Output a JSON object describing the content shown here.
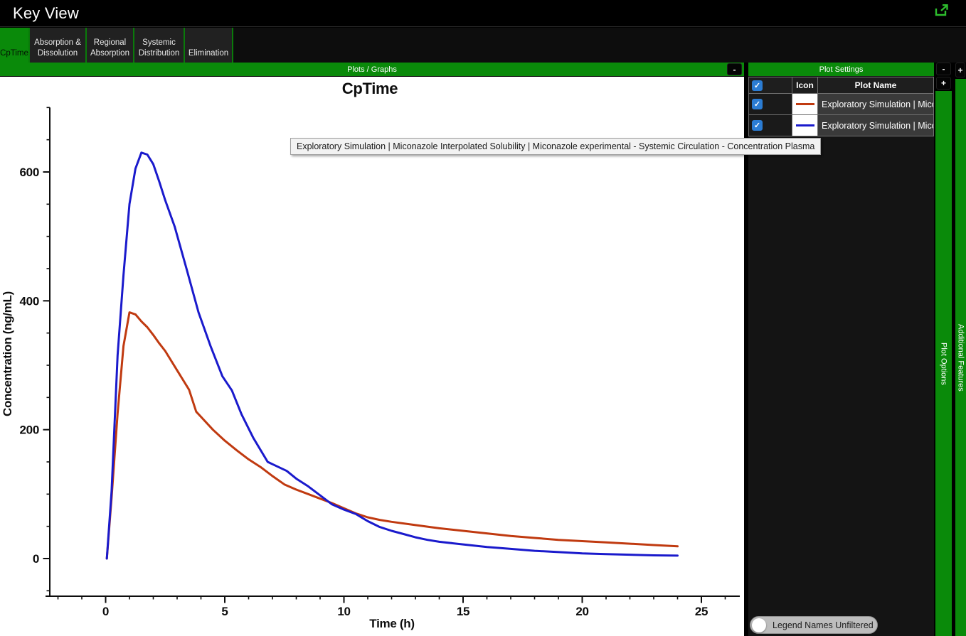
{
  "titlebar": {
    "title": "Key View",
    "icon": "open-external-icon"
  },
  "tabs": [
    {
      "label": "CpTime",
      "selected": true
    },
    {
      "label": "Absorption & Dissolution",
      "selected": false
    },
    {
      "label": "Regional Absorption",
      "selected": false
    },
    {
      "label": "Systemic Distribution",
      "selected": false
    },
    {
      "label": "Elimination",
      "selected": false
    }
  ],
  "plots_panel": {
    "title": "Plots / Graphs",
    "collapse_label": "-"
  },
  "plot_settings": {
    "title": "Plot Settings",
    "collapse_label": "-",
    "add_row_label": "+",
    "header_checked": true,
    "columns": {
      "icon": "Icon",
      "name": "Plot Name"
    },
    "rows": [
      {
        "checked": true,
        "line_color": "#c03a10",
        "name": "Exploratory Simulation | Mico"
      },
      {
        "checked": true,
        "line_color": "#1a1acc",
        "name": "Exploratory Simulation | Mico"
      }
    ]
  },
  "side_tabs": {
    "plot_options": {
      "label": "Plot Options"
    },
    "additional_features": {
      "label": "Additional Features",
      "add_label": "+"
    }
  },
  "tooltip": {
    "text": "Exploratory Simulation | Miconazole Interpolated Solubility | Miconazole experimental - Systemic Circulation - Concentration Plasma"
  },
  "legend_toggle": {
    "label": "Legend Names Unfiltered",
    "on": false
  },
  "colors": {
    "accent_green": "#0a8a0a",
    "titlebar_icon_green": "#2dbd2d",
    "checkbox_blue": "#2b7cd3",
    "series_red": "#c03a10",
    "series_blue": "#1a1acc",
    "axis_black": "#0d0d0d"
  },
  "chart_data": {
    "type": "line",
    "title": "CpTime",
    "xlabel": "Time (h)",
    "ylabel": "Concentration (ng/mL)",
    "xlim": [
      -2.5,
      26.6
    ],
    "ylim": [
      -58,
      700
    ],
    "x_ticks_major": [
      0,
      5,
      10,
      15,
      20,
      25
    ],
    "x_minor_step": 1,
    "x_minor_range": [
      -2,
      26
    ],
    "y_ticks_major": [
      0,
      200,
      400,
      600
    ],
    "y_minor_step": 50,
    "y_minor_range": [
      -50,
      700
    ],
    "grid": false,
    "legend_position": "none",
    "series": [
      {
        "name": "Exploratory Simulation | Mico (red)",
        "color": "#c03a10",
        "points": [
          [
            0.05,
            0
          ],
          [
            0.25,
            95
          ],
          [
            0.5,
            225
          ],
          [
            0.75,
            330
          ],
          [
            1,
            382
          ],
          [
            1.25,
            379
          ],
          [
            1.5,
            368
          ],
          [
            1.75,
            359
          ],
          [
            2,
            347
          ],
          [
            2.25,
            334
          ],
          [
            2.5,
            322
          ],
          [
            3,
            292
          ],
          [
            3.5,
            262
          ],
          [
            3.8,
            228
          ],
          [
            4,
            220
          ],
          [
            4.5,
            200
          ],
          [
            5,
            183
          ],
          [
            5.5,
            168
          ],
          [
            6,
            154
          ],
          [
            6.5,
            142
          ],
          [
            7,
            128
          ],
          [
            7.5,
            115
          ],
          [
            8,
            107
          ],
          [
            8.5,
            100
          ],
          [
            9,
            93
          ],
          [
            9.5,
            86
          ],
          [
            10,
            78
          ],
          [
            10.5,
            70
          ],
          [
            11,
            64
          ],
          [
            11.5,
            60
          ],
          [
            12,
            57
          ],
          [
            13,
            52
          ],
          [
            14,
            47
          ],
          [
            15,
            43
          ],
          [
            16,
            39
          ],
          [
            17,
            35
          ],
          [
            18,
            32
          ],
          [
            19,
            29
          ],
          [
            20,
            27
          ],
          [
            21,
            25
          ],
          [
            22,
            23
          ],
          [
            23,
            21
          ],
          [
            24,
            19
          ]
        ]
      },
      {
        "name": "Exploratory Simulation | Mico (blue)",
        "color": "#1a1acc",
        "points": [
          [
            0.05,
            0
          ],
          [
            0.25,
            105
          ],
          [
            0.5,
            315
          ],
          [
            0.75,
            440
          ],
          [
            1,
            550
          ],
          [
            1.25,
            605
          ],
          [
            1.5,
            630
          ],
          [
            1.75,
            627
          ],
          [
            2,
            612
          ],
          [
            2.25,
            585
          ],
          [
            2.5,
            556
          ],
          [
            2.9,
            515
          ],
          [
            3.4,
            449
          ],
          [
            3.9,
            382
          ],
          [
            4.4,
            330
          ],
          [
            4.9,
            283
          ],
          [
            5.3,
            261
          ],
          [
            5.7,
            224
          ],
          [
            6.2,
            187
          ],
          [
            6.8,
            150
          ],
          [
            7.6,
            136
          ],
          [
            8,
            124
          ],
          [
            8.5,
            112
          ],
          [
            9,
            98
          ],
          [
            9.5,
            84
          ],
          [
            10,
            76
          ],
          [
            10.5,
            69
          ],
          [
            11,
            58
          ],
          [
            11.5,
            49
          ],
          [
            12,
            43
          ],
          [
            12.5,
            38
          ],
          [
            13,
            33
          ],
          [
            13.5,
            29
          ],
          [
            14,
            26
          ],
          [
            15,
            22
          ],
          [
            16,
            18
          ],
          [
            17,
            15
          ],
          [
            18,
            12
          ],
          [
            19,
            10
          ],
          [
            20,
            8
          ],
          [
            21,
            7
          ],
          [
            22,
            6
          ],
          [
            23,
            5
          ],
          [
            24,
            4.5
          ]
        ]
      }
    ]
  }
}
